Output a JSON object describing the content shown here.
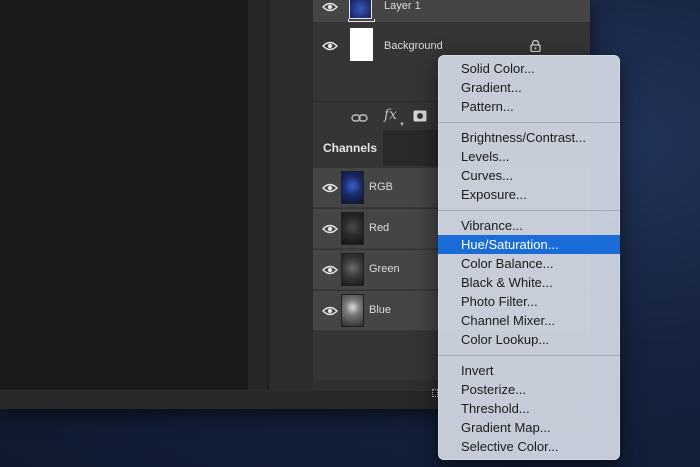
{
  "layers": [
    {
      "name": "Layer 1",
      "selected": true,
      "thumb": "blue-texture"
    },
    {
      "name": "Background",
      "selected": false,
      "thumb": "white",
      "locked": true
    }
  ],
  "layers_toolbar": {
    "icons": [
      "link-icon",
      "fx-icon",
      "mask-icon"
    ],
    "fx_label": "fx"
  },
  "channels_panel": {
    "tab_label": "Channels",
    "channels": [
      {
        "name": "RGB",
        "thumb_color": "#1b2a6b"
      },
      {
        "name": "Red",
        "thumb_color": "#2a2a2a"
      },
      {
        "name": "Green",
        "thumb_color": "#3a3a3a"
      },
      {
        "name": "Blue",
        "thumb_color": "#5a5a5a"
      }
    ]
  },
  "adjustment_menu": {
    "groups": [
      [
        "Solid Color...",
        "Gradient...",
        "Pattern..."
      ],
      [
        "Brightness/Contrast...",
        "Levels...",
        "Curves...",
        "Exposure..."
      ],
      [
        "Vibrance...",
        "Hue/Saturation...",
        "Color Balance...",
        "Black & White...",
        "Photo Filter...",
        "Channel Mixer...",
        "Color Lookup..."
      ],
      [
        "Invert",
        "Posterize...",
        "Threshold...",
        "Gradient Map...",
        "Selective Color..."
      ]
    ],
    "highlighted": "Hue/Saturation..."
  },
  "colors": {
    "menu_highlight": "#1a6dd6",
    "panel_bg": "#353535",
    "selected_row": "#454545"
  }
}
